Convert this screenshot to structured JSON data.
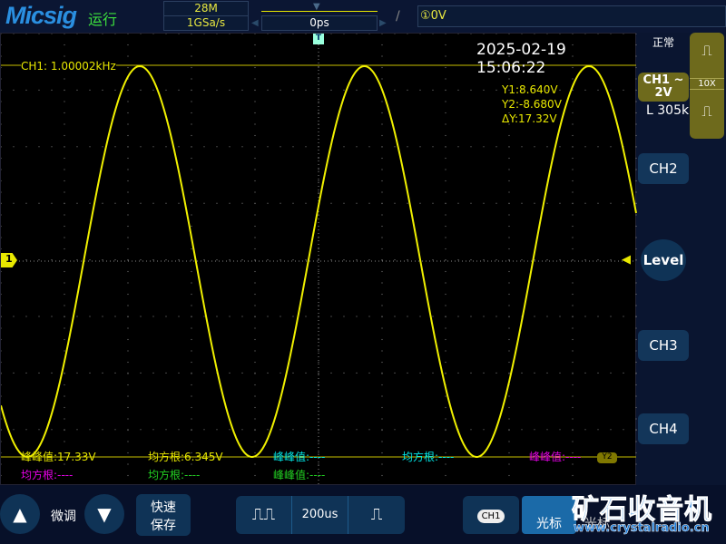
{
  "header": {
    "brand": "Micsig",
    "run_state": "运行",
    "memory_depth": "28M",
    "sample_rate": "1GSa/s",
    "time_offset": "0ps",
    "trigger_level": "①0V"
  },
  "screen": {
    "timestamp": "2025-02-19 15:06:22",
    "ch1_freq": "CH1: 1.00002kHz",
    "channel_marker": "1",
    "cursor": {
      "y1": "Y1:8.640V",
      "y2": "Y2:-8.680V",
      "dy": "ΔY:17.32V",
      "y2_label": "Y2"
    },
    "trigger_marker": "T",
    "measurements": [
      {
        "text": "峰峰值:17.33V",
        "color": "#e8e800"
      },
      {
        "text": "均方根:6.345V",
        "color": "#e8e800"
      },
      {
        "text": "峰峰值:----",
        "color": "#00e8e8"
      },
      {
        "text": "均方根:----",
        "color": "#00e8e8"
      },
      {
        "text": "峰峰值:----",
        "color": "#e800e8"
      },
      {
        "text": "均方根:----",
        "color": "#e800e8"
      },
      {
        "text": "均方根:----",
        "color": "#22d022"
      },
      {
        "text": "峰峰值:----",
        "color": "#22d022"
      }
    ],
    "trace_color": "#f0f000"
  },
  "right_panel": {
    "mode": "正常",
    "ch1_label": "CH1 ~",
    "ch1_scale": "2V",
    "probe": "10X",
    "memory": "L 305k",
    "ch2": "CH2",
    "level": "Level",
    "ch3": "CH3",
    "ch4": "CH4"
  },
  "bottom": {
    "fine_adjust": "微调",
    "quick_save_1": "快速",
    "quick_save_2": "保存",
    "timebase": "200us",
    "ch1_badge": "CH1",
    "cursor_label": "光标",
    "cursor_label2": "光标"
  },
  "watermark": {
    "cn": "矿石收音机",
    "url": "www.crystalradio.cn"
  }
}
